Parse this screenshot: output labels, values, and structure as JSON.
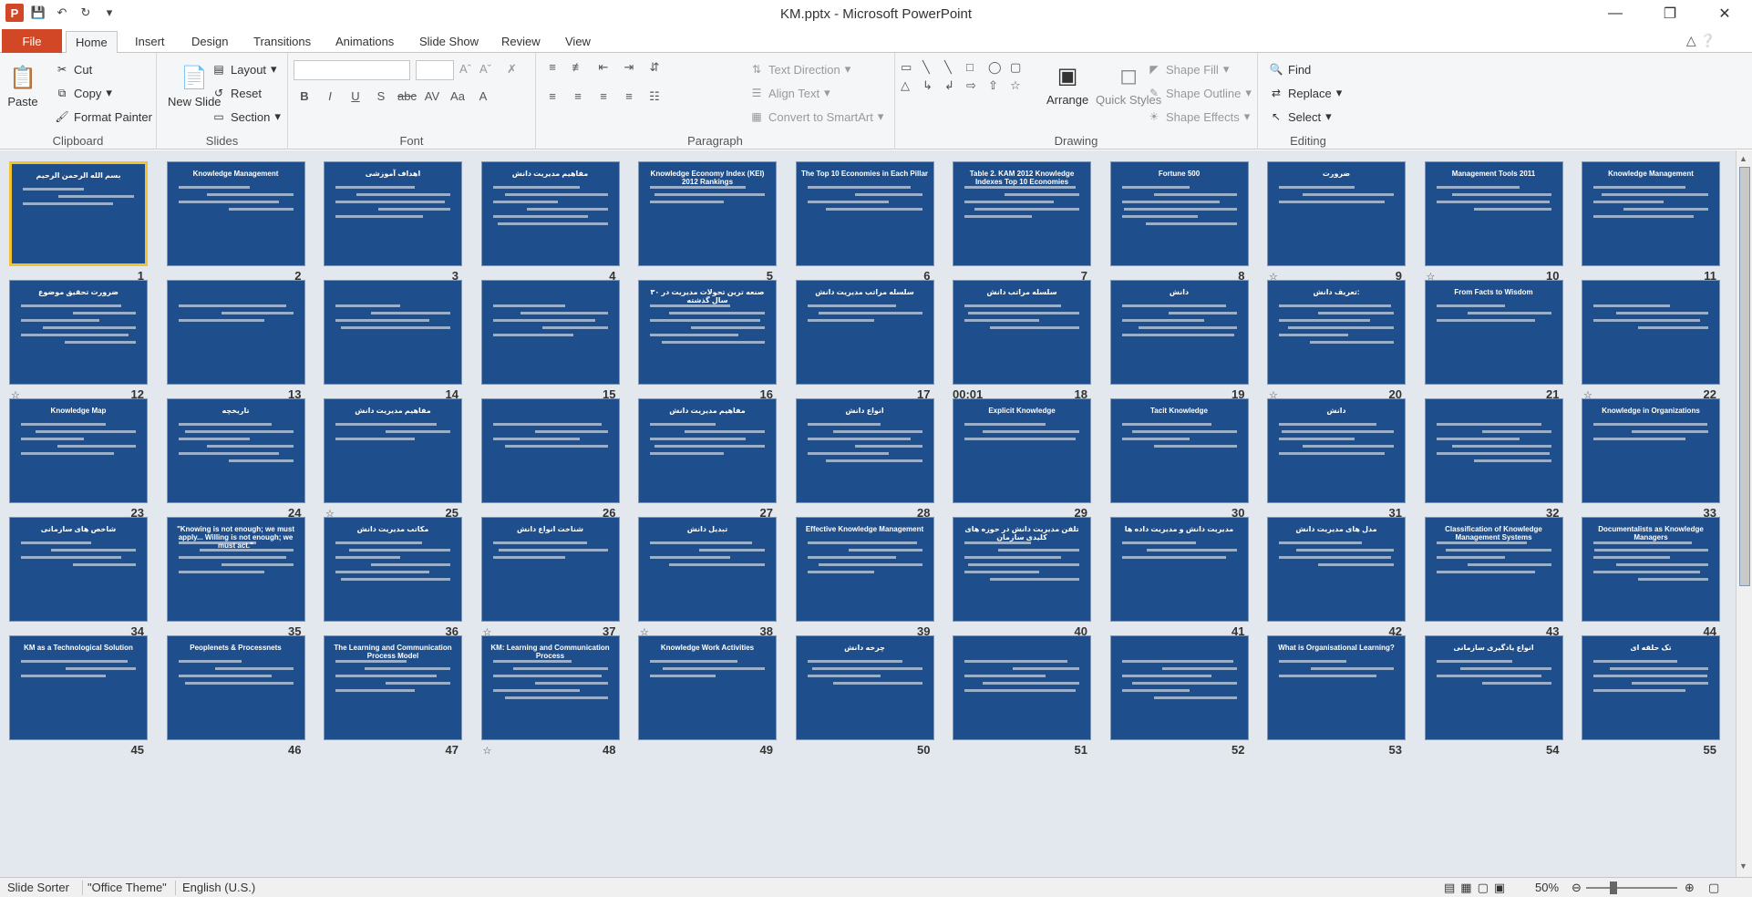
{
  "window": {
    "title": "KM.pptx  -  Microsoft PowerPoint",
    "app_icon": "P"
  },
  "tabs": [
    {
      "label": "File"
    },
    {
      "label": "Home"
    },
    {
      "label": "Insert"
    },
    {
      "label": "Design"
    },
    {
      "label": "Transitions"
    },
    {
      "label": "Animations"
    },
    {
      "label": "Slide Show"
    },
    {
      "label": "Review"
    },
    {
      "label": "View"
    }
  ],
  "ribbon": {
    "clipboard": {
      "label": "Clipboard",
      "paste": "Paste",
      "cut": "Cut",
      "copy": "Copy",
      "format_painter": "Format Painter"
    },
    "slides": {
      "label": "Slides",
      "new_slide": "New Slide",
      "layout": "Layout",
      "reset": "Reset",
      "section": "Section"
    },
    "font": {
      "label": "Font"
    },
    "paragraph": {
      "label": "Paragraph",
      "text_direction": "Text Direction",
      "align_text": "Align Text",
      "convert": "Convert to SmartArt"
    },
    "drawing": {
      "label": "Drawing",
      "arrange": "Arrange",
      "quick_styles": "Quick Styles",
      "shape_fill": "Shape Fill",
      "shape_outline": "Shape Outline",
      "shape_effects": "Shape Effects"
    },
    "editing": {
      "label": "Editing",
      "find": "Find",
      "replace": "Replace",
      "select": "Select"
    }
  },
  "slides": [
    {
      "num": "1",
      "title": "بسم الله الرحمن الرحيم",
      "selected": true
    },
    {
      "num": "2",
      "title": "Knowledge Management"
    },
    {
      "num": "3",
      "title": "اهداف آموزشی"
    },
    {
      "num": "4",
      "title": "مفاهیم مدیریت دانش"
    },
    {
      "num": "5",
      "title": "Knowledge Economy Index (KEI) 2012 Rankings"
    },
    {
      "num": "6",
      "title": "The Top 10 Economies in Each Pillar"
    },
    {
      "num": "7",
      "title": "Table 2. KAM 2012 Knowledge Indexes Top 10 Economies"
    },
    {
      "num": "8",
      "title": "Fortune 500"
    },
    {
      "num": "9",
      "title": "ضرورت"
    },
    {
      "num": "10",
      "title": "Management Tools 2011"
    },
    {
      "num": "11",
      "title": "Knowledge Management"
    },
    {
      "num": "12",
      "title": "ضرورت تحقیق موضوع"
    },
    {
      "num": "13",
      "title": ""
    },
    {
      "num": "14",
      "title": ""
    },
    {
      "num": "15",
      "title": ""
    },
    {
      "num": "16",
      "title": "صنعه ترین تحولات مدیریت در ۳۰ سال گذشته"
    },
    {
      "num": "17",
      "title": "سلسله مراتب مدیریت دانش"
    },
    {
      "num": "18",
      "title": "سلسله مراتب دانش",
      "timing": "00:01"
    },
    {
      "num": "19",
      "title": "دانش"
    },
    {
      "num": "20",
      "title": "تعریف دانش:"
    },
    {
      "num": "21",
      "title": "From Facts to Wisdom"
    },
    {
      "num": "22",
      "title": ""
    },
    {
      "num": "23",
      "title": "Knowledge Map"
    },
    {
      "num": "24",
      "title": "تاریخچه"
    },
    {
      "num": "25",
      "title": "مفاهیم مدیریت دانش"
    },
    {
      "num": "26",
      "title": ""
    },
    {
      "num": "27",
      "title": "مفاهیم مدیریت دانش"
    },
    {
      "num": "28",
      "title": "انواع دانش"
    },
    {
      "num": "29",
      "title": "Explicit Knowledge"
    },
    {
      "num": "30",
      "title": "Tacit Knowledge"
    },
    {
      "num": "31",
      "title": "دانش"
    },
    {
      "num": "32",
      "title": ""
    },
    {
      "num": "33",
      "title": "Knowledge in Organizations"
    },
    {
      "num": "34",
      "title": "شاخص های سازمانی"
    },
    {
      "num": "35",
      "title": "\"Knowing is not enough; we must apply... Willing is not enough; we must act.\""
    },
    {
      "num": "36",
      "title": "مکاتب مدیریت دانش"
    },
    {
      "num": "37",
      "title": "شناخت انواع دانش"
    },
    {
      "num": "38",
      "title": "تبدیل دانش"
    },
    {
      "num": "39",
      "title": "Effective Knowledge Management"
    },
    {
      "num": "40",
      "title": "تلفن مدیریت دانش در حوزه های کلیدی سازمان"
    },
    {
      "num": "41",
      "title": "مدیریت دانش و مدیریت داده ها"
    },
    {
      "num": "42",
      "title": "مدل های مدیریت دانش"
    },
    {
      "num": "43",
      "title": "Classification of Knowledge Management Systems"
    },
    {
      "num": "44",
      "title": "Documentalists as Knowledge Managers"
    },
    {
      "num": "45",
      "title": "KM as a Technological Solution"
    },
    {
      "num": "46",
      "title": "Peoplenets & Processnets"
    },
    {
      "num": "47",
      "title": "The Learning and Communication Process Model"
    },
    {
      "num": "48",
      "title": "KM: Learning and Communication Process"
    },
    {
      "num": "49",
      "title": "Knowledge Work Activities"
    },
    {
      "num": "50",
      "title": "چرخه دانش"
    },
    {
      "num": "51",
      "title": ""
    },
    {
      "num": "52",
      "title": ""
    },
    {
      "num": "53",
      "title": "What is Organisational Learning?"
    },
    {
      "num": "54",
      "title": "انواع یادگیری سازمانی"
    },
    {
      "num": "55",
      "title": "تک حلقه ای"
    }
  ],
  "transition_icon": "☆",
  "status": {
    "view": "Slide Sorter",
    "theme": "\"Office Theme\"",
    "language": "English (U.S.)",
    "zoom": "50%"
  }
}
